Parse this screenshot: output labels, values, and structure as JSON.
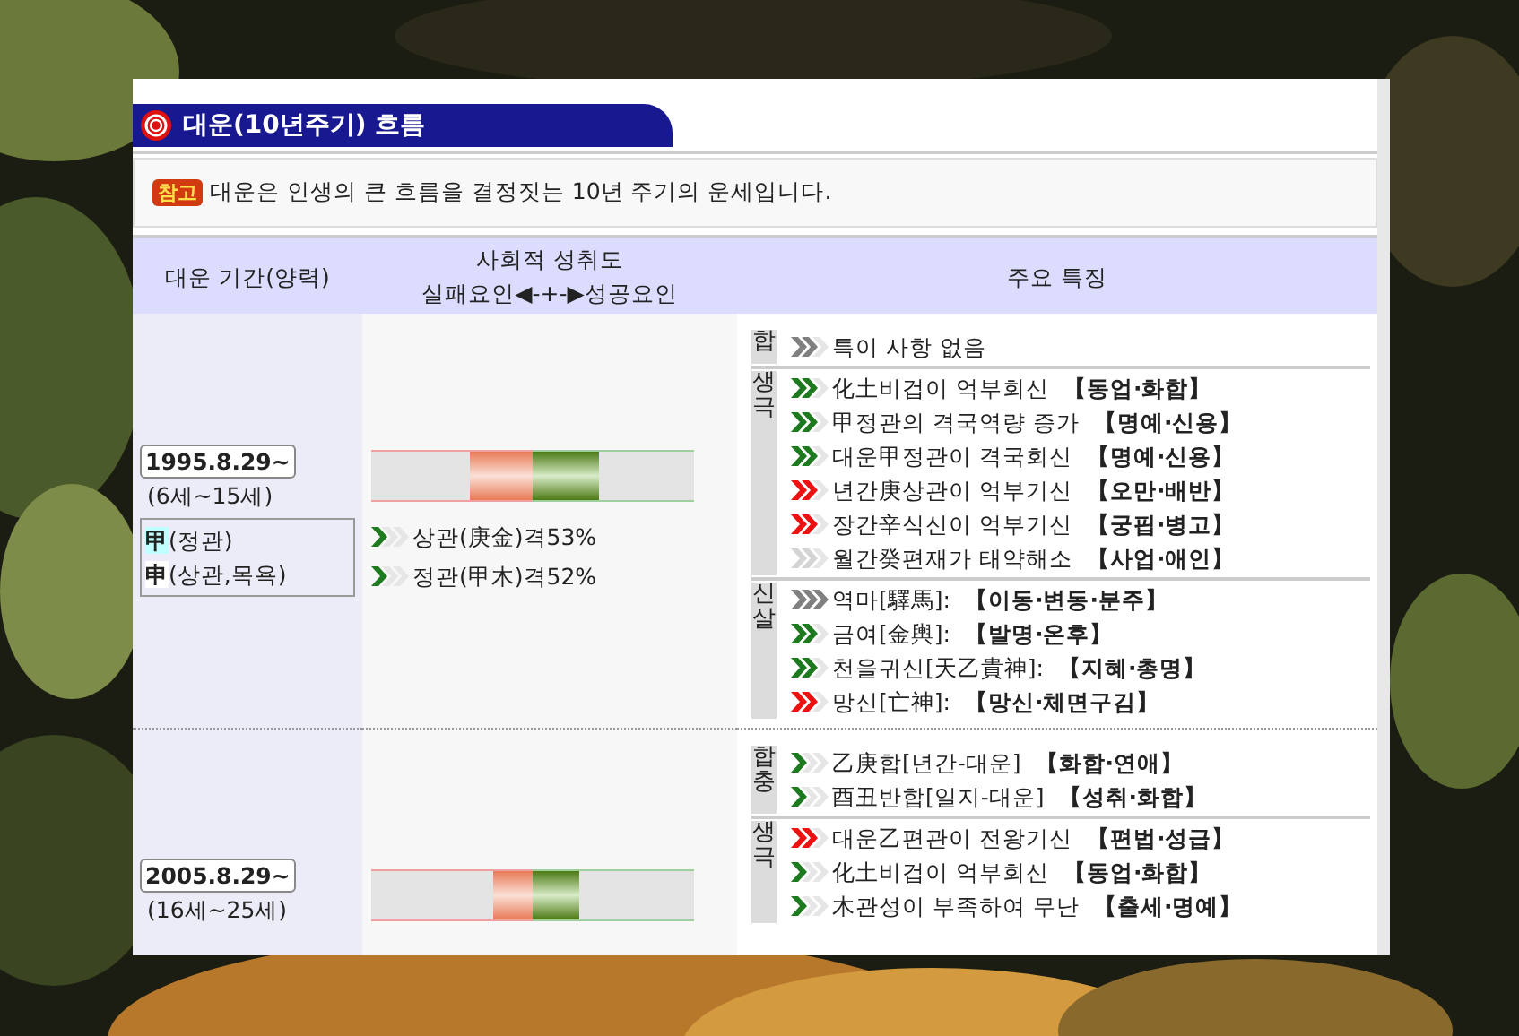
{
  "title": "대운(10년주기) 흐름",
  "note": {
    "badge": "참고",
    "text": "대운은 인생의 큰 흐름을 결정짓는 10년 주기의 운세입니다."
  },
  "header": {
    "period": "대운 기간(양력)",
    "achievement": "사회적 성취도",
    "scale": "실패요인◀-+-▶성공요인",
    "features": "주요 특징"
  },
  "periods": [
    {
      "date": "1995.8.29~",
      "ages": "(6세~15세)",
      "stems": [
        {
          "char": "甲",
          "text": "(정관)",
          "color": "#c0ffff"
        },
        {
          "char": "申",
          "text": "(상관,목욕)",
          "color": "#ffffff"
        }
      ],
      "bar": {
        "failure": {
          "level": 0.39
        },
        "success": {
          "level": 0.41
        }
      },
      "factors": [
        {
          "kind": "single",
          "color": "#1e7a1e",
          "text": "상관(庚金)격53%"
        },
        {
          "kind": "single",
          "color": "#1e7a1e",
          "text": "정관(甲木)격52%"
        }
      ],
      "groups": [
        {
          "label": "합",
          "items": [
            {
              "kind": "double",
              "color": "#808080",
              "text": "특이 사항 없음"
            }
          ]
        },
        {
          "label": "생극",
          "items": [
            {
              "kind": "double",
              "color": "#1e7a1e",
              "text": "化土비겁이 억부회신",
              "tag": "【동업·화합】"
            },
            {
              "kind": "double",
              "color": "#1e7a1e",
              "text": "甲정관의 격국역량 증가",
              "tag": "【명예·신용】"
            },
            {
              "kind": "double",
              "color": "#1e7a1e",
              "text": "대운甲정관이 격국회신",
              "tag": "【명예·신용】"
            },
            {
              "kind": "double",
              "color": "#ee1111",
              "text": "년간庚상관이 억부기신",
              "tag": "【오만·배반】"
            },
            {
              "kind": "double",
              "color": "#ee1111",
              "text": "장간辛식신이 억부기신",
              "tag": "【궁핍·병고】"
            },
            {
              "kind": "double",
              "color": "#d4d4d4",
              "text": "월간癸편재가 태약해소",
              "tag": "【사업·애인】"
            }
          ]
        },
        {
          "label": "신살",
          "items": [
            {
              "kind": "triple",
              "color": "#808080",
              "text": "역마[驛馬]:",
              "tag": "【이동·변동·분주】"
            },
            {
              "kind": "double",
              "color": "#1e7a1e",
              "text": "금여[金輿]:",
              "tag": "【발명·온후】"
            },
            {
              "kind": "double",
              "color": "#1e7a1e",
              "text": "천을귀신[天乙貴神]:",
              "tag": "【지혜·총명】"
            },
            {
              "kind": "double",
              "color": "#ee1111",
              "text": "망신[亡神]:",
              "tag": "【망신·체면구김】"
            }
          ]
        }
      ]
    },
    {
      "date": "2005.8.29~",
      "ages": "(16세~25세)",
      "bar": {
        "failure": {
          "level": 0.24
        },
        "success": {
          "level": 0.29
        }
      },
      "groups": [
        {
          "label": "합충",
          "items": [
            {
              "kind": "single",
              "color": "#1e7a1e",
              "text": "乙庚합[년간-대운]",
              "tag": "【화합·연애】"
            },
            {
              "kind": "single",
              "color": "#1e7a1e",
              "text": "酉丑반합[일지-대운]",
              "tag": "【성취·화합】"
            }
          ]
        },
        {
          "label": "생극",
          "items": [
            {
              "kind": "double",
              "color": "#ee1111",
              "text": "대운乙편관이 전왕기신",
              "tag": "【편법·성급】"
            },
            {
              "kind": "single",
              "color": "#1e7a1e",
              "text": "化土비겁이 억부회신",
              "tag": "【동업·화합】"
            },
            {
              "kind": "single",
              "color": "#1e7a1e",
              "text": "木관성이 부족하여 무난",
              "tag": "【출세·명예】"
            }
          ]
        }
      ]
    }
  ]
}
